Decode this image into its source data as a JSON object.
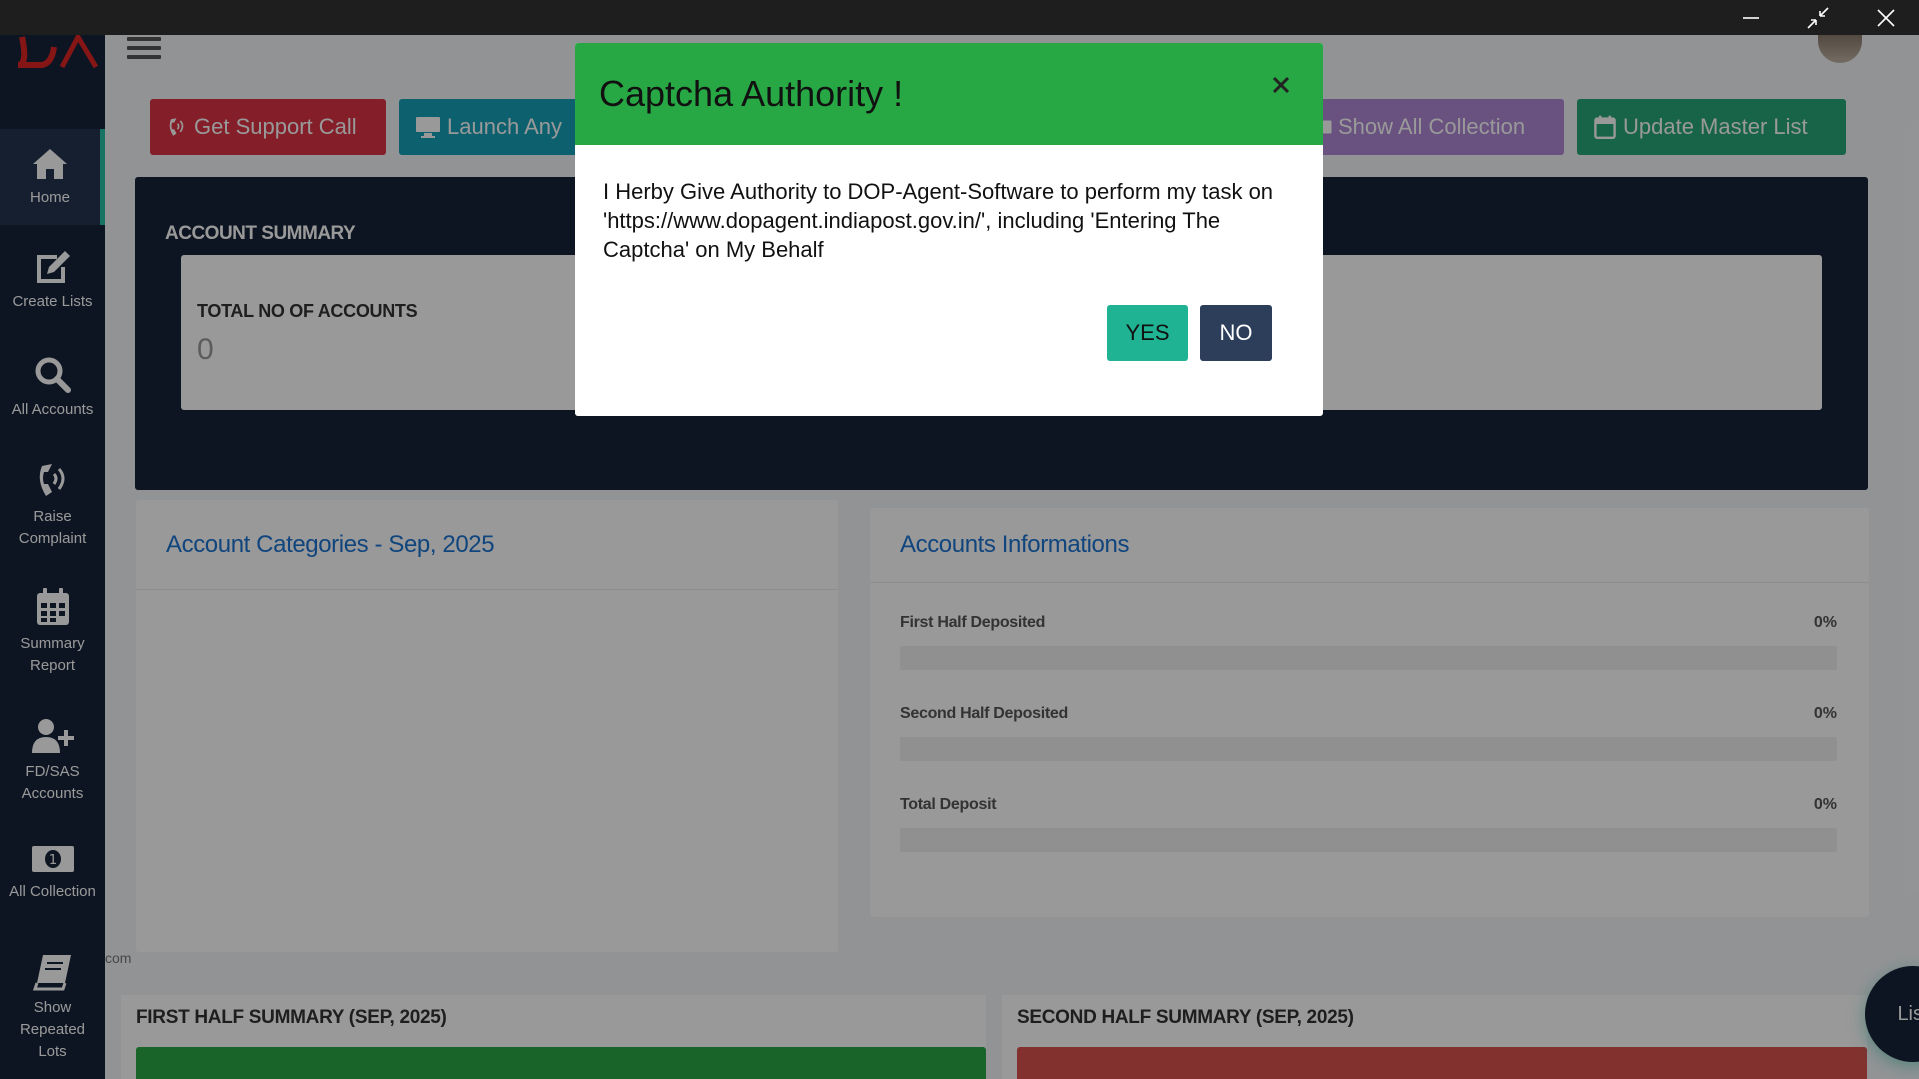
{
  "window": {
    "minimize_icon": "minimize-icon",
    "restore_icon": "restore-icon",
    "close_icon": "close-icon"
  },
  "sidebar": {
    "items": [
      {
        "label": "Home",
        "icon": "home-icon"
      },
      {
        "label": "Create Lists",
        "icon": "edit-icon"
      },
      {
        "label": "All Accounts",
        "icon": "search-icon"
      },
      {
        "label": "Raise Complaint",
        "icon": "phone-volume-icon"
      },
      {
        "label": "Summary Report",
        "icon": "calendar-icon"
      },
      {
        "label": "FD/SAS Accounts",
        "icon": "user-plus-icon"
      },
      {
        "label": "All Collection",
        "icon": "money-icon"
      },
      {
        "label": "Show Repeated Lots",
        "icon": "book-icon"
      }
    ]
  },
  "toolbar": {
    "support_call": "Get Support Call",
    "launch_any": "Launch Any",
    "show_all_collection": "Show All Collection",
    "update_master_list": "Update Master List"
  },
  "account_summary": {
    "title": "ACCOUNT SUMMARY",
    "total_label": "TOTAL NO OF ACCOUNTS",
    "total_value": "0"
  },
  "categories_panel": {
    "title": "Account Categories - Sep, 2025"
  },
  "info_panel": {
    "title": "Accounts Informations",
    "rows": [
      {
        "label": "First Half Deposited",
        "pct": "0%",
        "value": 0
      },
      {
        "label": "Second Half Deposited",
        "pct": "0%",
        "value": 0
      },
      {
        "label": "Total Deposit",
        "pct": "0%",
        "value": 0
      }
    ]
  },
  "first_half": {
    "title": "FIRST HALF SUMMARY (SEP, 2025)"
  },
  "second_half": {
    "title": "SECOND HALF SUMMARY (SEP, 2025)"
  },
  "footer_text": "com",
  "fab": {
    "label": "List"
  },
  "modal": {
    "title": "Captcha Authority !",
    "body": "I Herby Give Authority to DOP-Agent-Software to perform my task on 'https://www.dopagent.indiapost.gov.in/', including 'Entering The Captcha' on My Behalf",
    "yes": "YES",
    "no": "NO"
  },
  "colors": {
    "sidebar": "#17233a",
    "modal_header": "#28a745",
    "yes_button": "#20b393",
    "no_button": "#2c3e5a",
    "support_btn": "#dc3545",
    "launch_btn": "#17a2b8",
    "collection_btn": "#b088d6",
    "master_btn": "#28a77a",
    "first_half_bar": "#28a745",
    "second_half_bar": "#d9534f"
  }
}
